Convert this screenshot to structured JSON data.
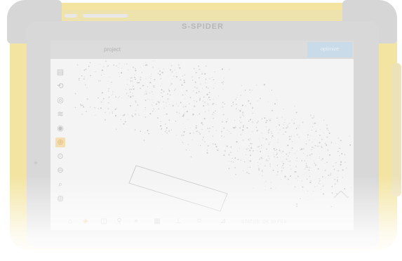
{
  "device": {
    "brand_label": "S-SPIDER"
  },
  "app": {
    "title": "project",
    "action_button": "optimize"
  },
  "left_toolbar": {
    "tools": [
      {
        "icon": "layers-icon",
        "glyph": "▤",
        "active": false
      },
      {
        "icon": "rotate-icon",
        "glyph": "⟲",
        "active": false
      },
      {
        "icon": "orbit-icon",
        "glyph": "◎",
        "active": false
      },
      {
        "icon": "layers-stack-icon",
        "glyph": "≋",
        "active": false
      },
      {
        "icon": "compass-icon",
        "glyph": "◉",
        "active": false
      },
      {
        "icon": "measure-icon",
        "glyph": "⊕",
        "active": true
      },
      {
        "icon": "zoom-in-icon",
        "glyph": "⊙",
        "active": false
      },
      {
        "icon": "zoom-out-icon",
        "glyph": "⊖",
        "active": false
      },
      {
        "icon": "zoom-fit-icon",
        "glyph": "⌕",
        "active": false
      },
      {
        "icon": "location-icon",
        "glyph": "◍",
        "active": false
      }
    ]
  },
  "bottom_toolbar": {
    "tools": [
      {
        "icon": "home-icon",
        "glyph": "⌂",
        "active": false
      },
      {
        "icon": "scan-icon",
        "glyph": "◈",
        "active": true
      },
      {
        "icon": "camera-icon",
        "glyph": "◫",
        "active": false
      },
      {
        "icon": "marker-icon",
        "glyph": "⚲",
        "active": false
      },
      {
        "icon": "target-icon",
        "glyph": "⌖",
        "active": false
      },
      {
        "icon": "grid-icon",
        "glyph": "▦",
        "active": false
      },
      {
        "icon": "level-icon",
        "glyph": "⊥",
        "active": false
      },
      {
        "icon": "tag-icon",
        "glyph": "⌑",
        "active": false
      },
      {
        "icon": "chart-icon",
        "glyph": "⊿",
        "active": false
      }
    ],
    "status": "STATUS: OK    30 FEB"
  },
  "colors": {
    "housing": "#f3e4a1",
    "bezel": "#d8d8d8",
    "accent": "#e7c98d",
    "action": "#c9dbe8"
  }
}
